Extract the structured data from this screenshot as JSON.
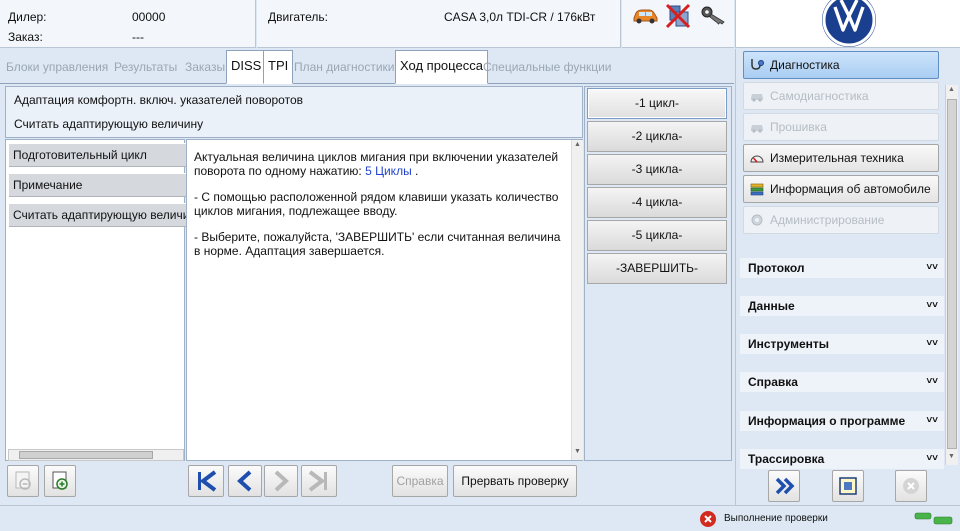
{
  "header": {
    "dealer_label": "Дилер:",
    "dealer_value": "00000",
    "order_label": "Заказ:",
    "order_value": "---",
    "engine_label": "Двигатель:",
    "engine_value": "CASA 3,0л TDI-CR / 176кВт",
    "icons": [
      "car-icon",
      "disconnected-icon",
      "key-icon"
    ],
    "logo": "vw-logo"
  },
  "tabs": [
    {
      "label": "Блоки управления",
      "state": "disabled"
    },
    {
      "label": "Результаты",
      "state": "disabled"
    },
    {
      "label": "Заказы",
      "state": "disabled"
    },
    {
      "label": "DISS",
      "state": "enabled"
    },
    {
      "label": "TPI",
      "state": "enabled"
    },
    {
      "label": "План диагностики",
      "state": "disabled"
    },
    {
      "label": "Ход процесса",
      "state": "active"
    },
    {
      "label": "Специальные функции",
      "state": "disabled"
    }
  ],
  "main": {
    "title_line1": "Адаптация комфортн. включ. указателей поворотов",
    "title_line2": "Считать адаптирующую величину",
    "steps": [
      "Подготовительный цикл",
      "Примечание",
      "Считать адаптирующую величину"
    ],
    "content": {
      "p1_text": "Актуальная величина циклов мигания при включении указателей поворота по одному нажатию: ",
      "p1_value": "5 Циклы",
      "p1_tail": " .",
      "p2": "- С помощью расположенной рядом клавиши указать количество циклов мигания, подлежащее вводу.",
      "p3": "- Выберите, пожалуйста, 'ЗАВЕРШИТЬ' если считанная величина в норме. Адаптация завершается."
    },
    "choices": [
      "-1 цикл-",
      "-2 цикла-",
      "-3 цикла-",
      "-4 цикла-",
      "-5 цикла-",
      "-ЗАВЕРШИТЬ-"
    ]
  },
  "toolbar": {
    "help_label": "Справка",
    "abort_label": "Прервать проверку"
  },
  "sidebar": {
    "buttons": [
      {
        "label": "Диагностика",
        "icon": "stethoscope-icon",
        "state": "selected"
      },
      {
        "label": "Самодиагностика",
        "icon": "car-diag-icon",
        "state": "disabled"
      },
      {
        "label": "Прошивка",
        "icon": "flash-icon",
        "state": "disabled"
      },
      {
        "label": "Измерительная техника",
        "icon": "gauge-icon",
        "state": "enabled"
      },
      {
        "label": "Информация об автомобиле",
        "icon": "books-icon",
        "state": "enabled"
      },
      {
        "label": "Администрирование",
        "icon": "admin-icon",
        "state": "disabled"
      }
    ],
    "sections": [
      "Протокол",
      "Данные",
      "Инструменты",
      "Справка",
      "Информация о программе",
      "Трассировка"
    ]
  },
  "status": {
    "text": "Выполнение проверки"
  },
  "colors": {
    "background": "#dde8f4",
    "selected": "#a9cdf2",
    "accent_blue": "#1e4fae",
    "value_highlight": "#2244cc"
  }
}
